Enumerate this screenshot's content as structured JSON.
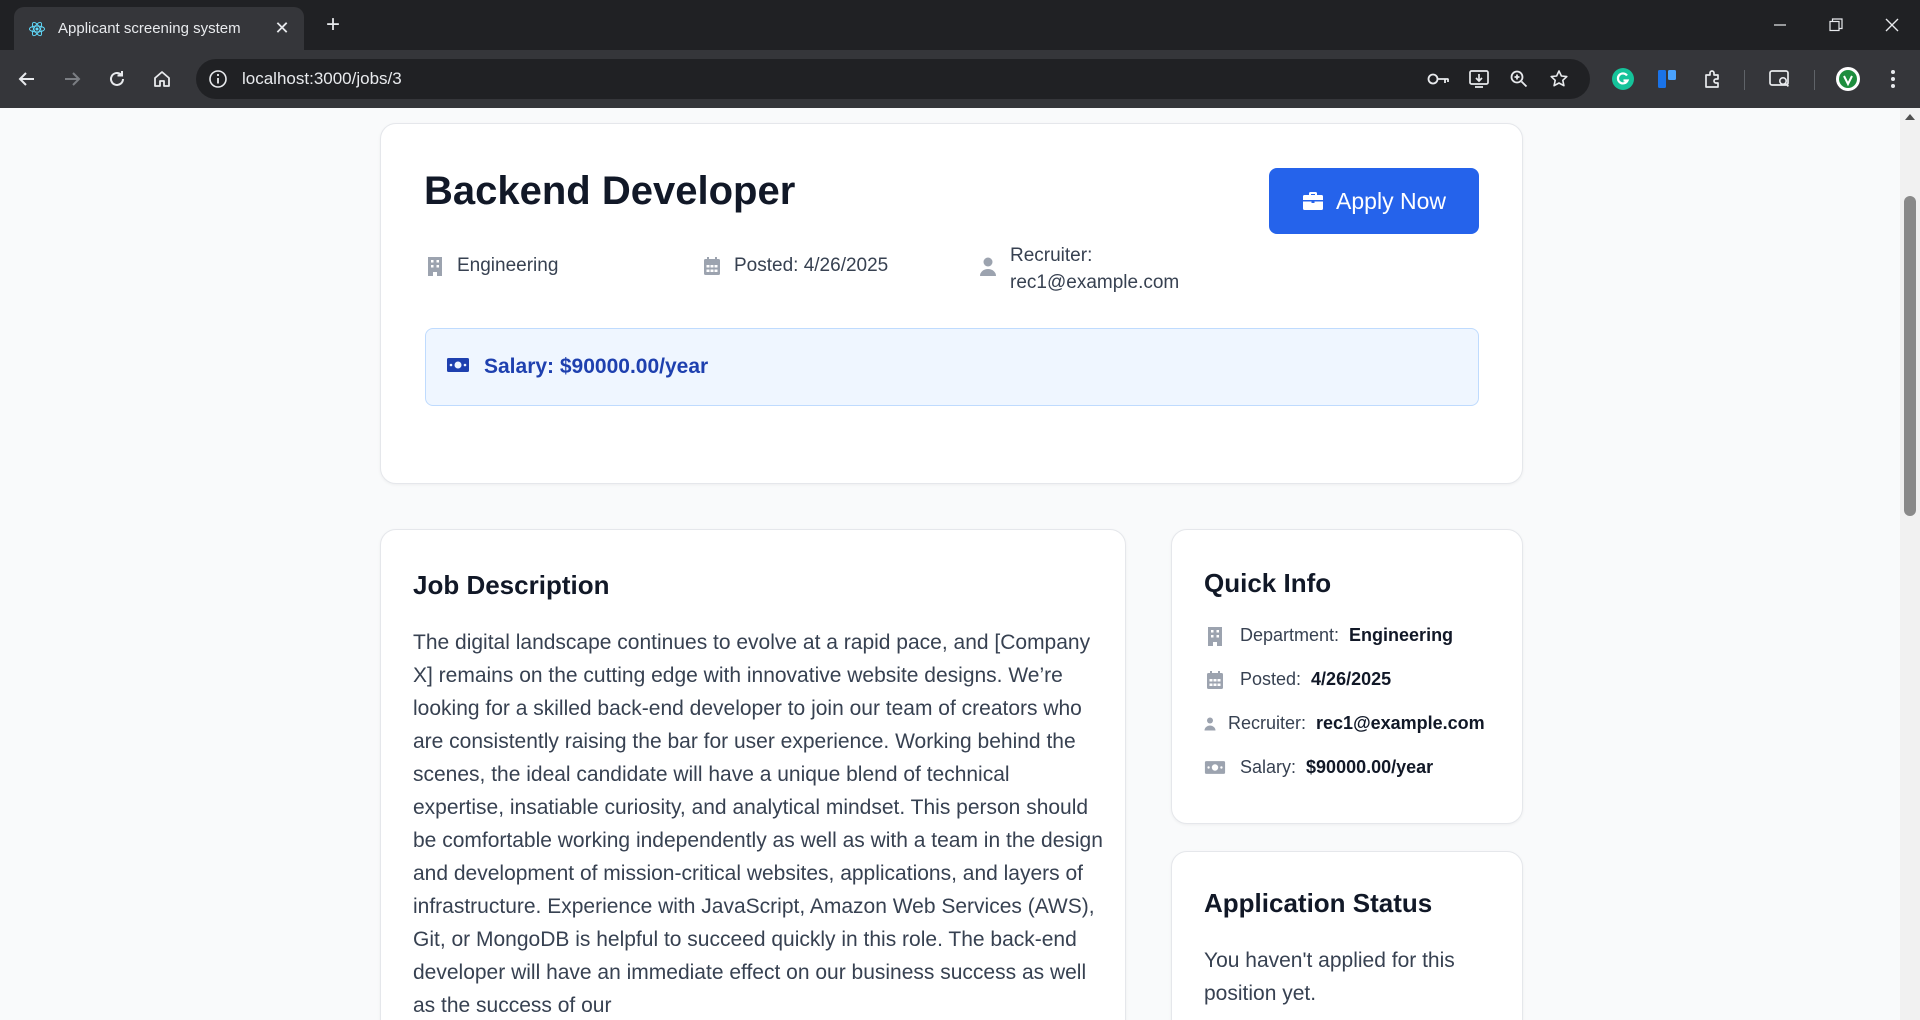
{
  "browser": {
    "tab_title": "Applicant screening system",
    "url": "localhost:3000/jobs/3"
  },
  "job": {
    "title": "Backend Developer",
    "apply_label": "Apply Now",
    "department": "Engineering",
    "posted": "Posted: 4/26/2025",
    "recruiter_label": "Recruiter:",
    "recruiter_email": "rec1@example.com",
    "salary": "Salary: $90000.00/year"
  },
  "description": {
    "heading": "Job Description",
    "body": "The digital landscape continues to evolve at a rapid pace, and [Company X] remains on the cutting edge with innovative website designs. We’re looking for a skilled back-end developer to join our team of creators who are consistently raising the bar for user experience. Working behind the scenes, the ideal candidate will have a unique blend of technical expertise, insatiable curiosity, and analytical mindset. This person should be comfortable working independently as well as with a team in the design and development of mission-critical websites, applications, and layers of infrastructure. Experience with JavaScript, Amazon Web Services (AWS), Git, or MongoDB is helpful to succeed quickly in this role. The back-end developer will have an immediate effect on our business success as well as the success of our"
  },
  "quick_info": {
    "heading": "Quick Info",
    "rows": [
      {
        "label": "Department:",
        "value": "Engineering",
        "icon": "building-icon"
      },
      {
        "label": "Posted:",
        "value": "4/26/2025",
        "icon": "calendar-icon"
      },
      {
        "label": "Recruiter:",
        "value": "rec1@example.com",
        "icon": "user-icon"
      },
      {
        "label": "Salary:",
        "value": "$90000.00/year",
        "icon": "money-icon"
      }
    ]
  },
  "application_status": {
    "heading": "Application Status",
    "message": "You haven't applied for this position yet."
  },
  "colors": {
    "primary": "#2563eb",
    "salary_bg": "#eff6ff",
    "salary_text": "#1e40af"
  }
}
